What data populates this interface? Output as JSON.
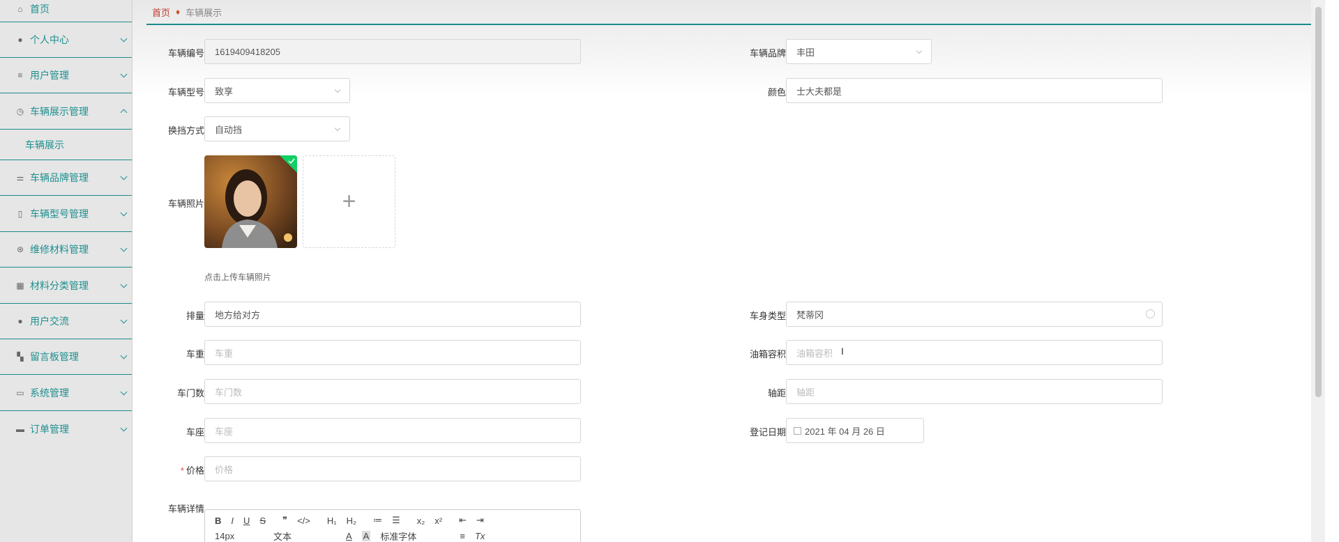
{
  "sidebar": {
    "home": "首页",
    "items": [
      {
        "label": "个人中心"
      },
      {
        "label": "用户管理"
      },
      {
        "label": "车辆展示管理"
      },
      {
        "label": "车辆品牌管理"
      },
      {
        "label": "车辆型号管理"
      },
      {
        "label": "维修材料管理"
      },
      {
        "label": "材料分类管理"
      },
      {
        "label": "用户交流"
      },
      {
        "label": "留言板管理"
      },
      {
        "label": "系统管理"
      },
      {
        "label": "订单管理"
      }
    ],
    "sub_item": "车辆展示"
  },
  "breadcrumb": {
    "home": "首页",
    "current": "车辆展示"
  },
  "form": {
    "vehicle_no": {
      "label": "车辆编号",
      "value": "1619409418205"
    },
    "brand": {
      "label": "车辆品牌",
      "value": "丰田"
    },
    "model": {
      "label": "车辆型号",
      "value": "致享"
    },
    "color": {
      "label": "颜色",
      "value": "士大夫都是"
    },
    "transmission": {
      "label": "换挡方式",
      "value": "自动挡"
    },
    "photo": {
      "label": "车辆照片",
      "hint": "点击上传车辆照片",
      "plus": "+"
    },
    "displacement": {
      "label": "排量",
      "value": "地方给对方"
    },
    "body_type": {
      "label": "车身类型",
      "value": "梵蒂冈"
    },
    "weight": {
      "label": "车重",
      "placeholder": "车重"
    },
    "tank": {
      "label": "油箱容积",
      "placeholder": "油箱容积"
    },
    "doors": {
      "label": "车门数",
      "placeholder": "车门数"
    },
    "wheelbase": {
      "label": "轴距",
      "placeholder": "轴距"
    },
    "seats": {
      "label": "车座",
      "placeholder": "车座"
    },
    "reg_date": {
      "label": "登记日期",
      "value": "2021 年 04 月 26 日"
    },
    "price": {
      "label": "价格",
      "required": "*",
      "placeholder": "价格"
    },
    "detail": {
      "label": "车辆详情"
    }
  },
  "editor": {
    "row1": [
      "B",
      "I",
      "U",
      "S",
      "❞",
      "</>",
      "H₁",
      "H₂",
      "≔",
      "☰",
      "x₂",
      "x²",
      "⇤",
      "⇥"
    ],
    "row2": [
      "14px",
      "文本",
      "A",
      "A",
      "标准字体",
      "≡",
      "Tx"
    ]
  },
  "colors": {
    "accent": "#1b8a8a",
    "danger": "#e74c3c"
  }
}
